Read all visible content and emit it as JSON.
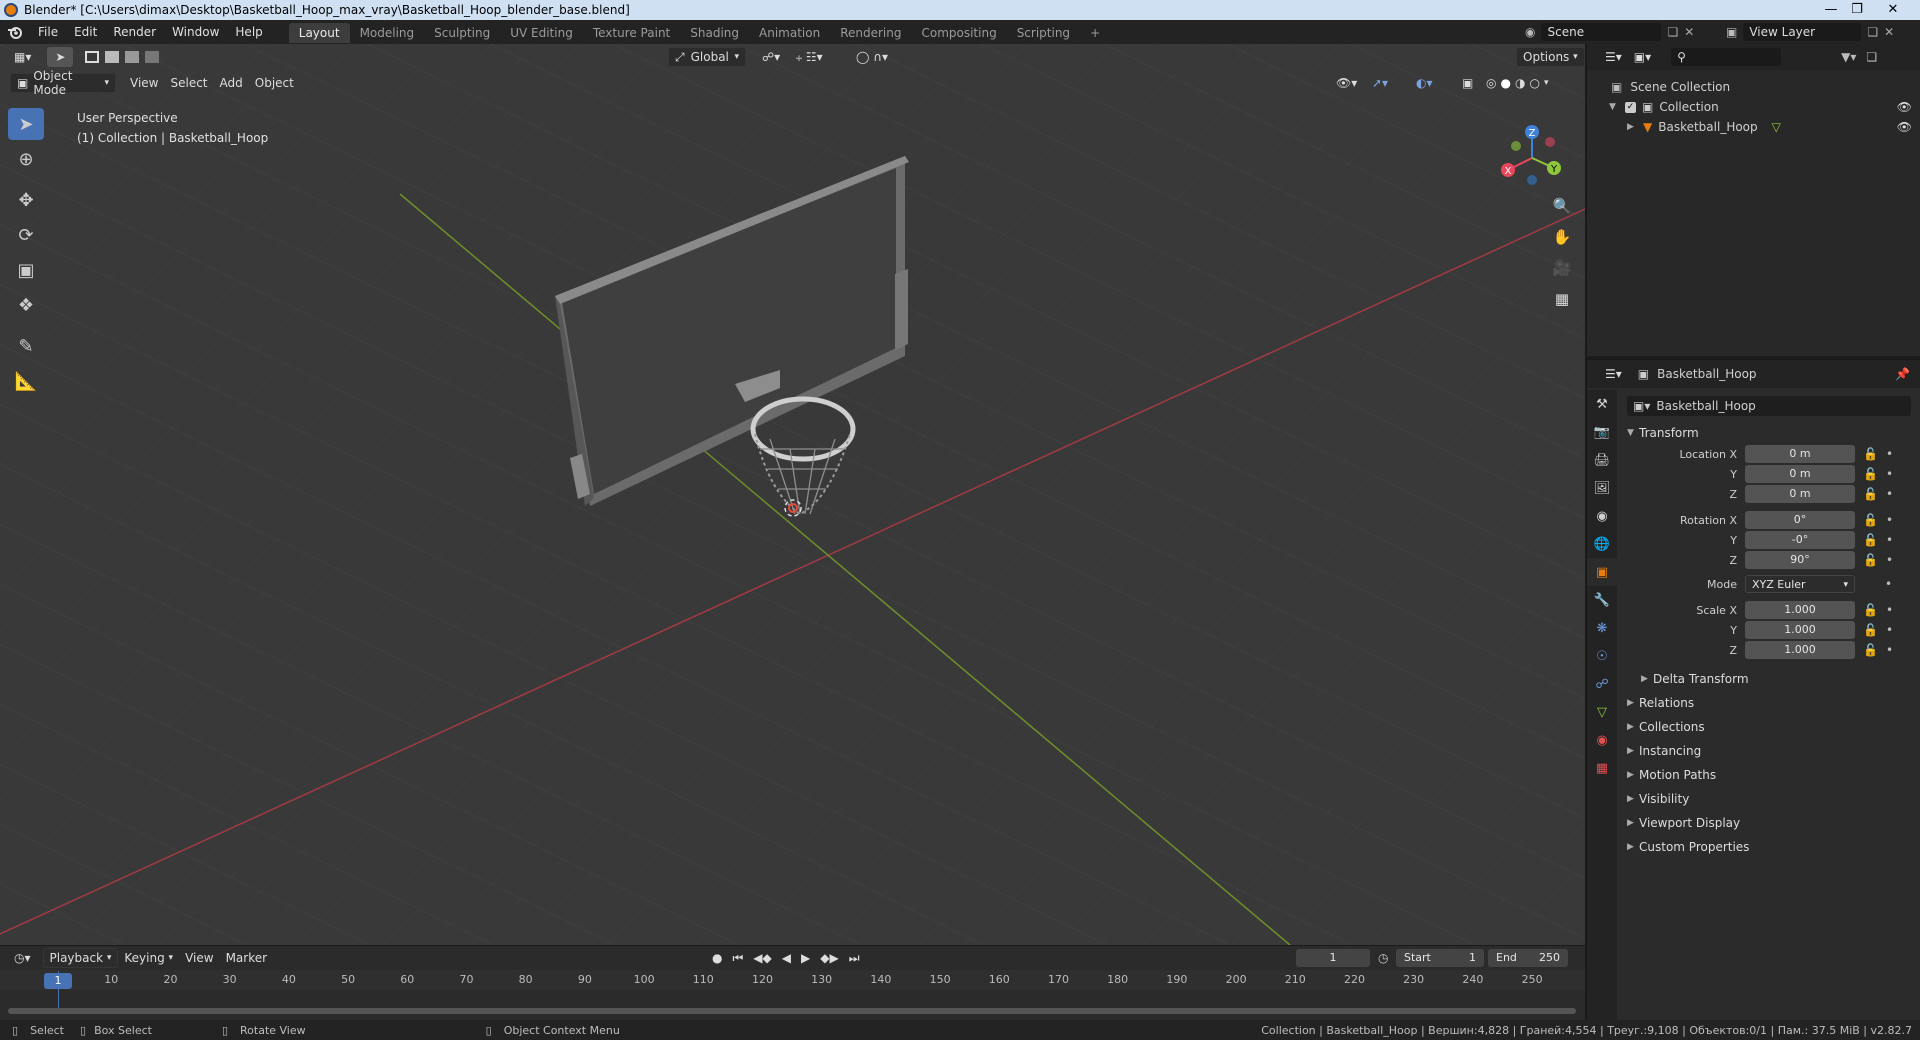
{
  "titlebar": {
    "text": "Blender* [C:\\Users\\dimax\\Desktop\\Basketball_Hoop_max_vray\\Basketball_Hoop_blender_base.blend]"
  },
  "menus": [
    "File",
    "Edit",
    "Render",
    "Window",
    "Help"
  ],
  "workspaces": [
    "Layout",
    "Modeling",
    "Sculpting",
    "UV Editing",
    "Texture Paint",
    "Shading",
    "Animation",
    "Rendering",
    "Compositing",
    "Scripting"
  ],
  "active_workspace": "Layout",
  "scene": {
    "name": "Scene",
    "view_layer": "View Layer"
  },
  "viewport": {
    "mode": "Object Mode",
    "menus": [
      "View",
      "Select",
      "Add",
      "Object"
    ],
    "transform_orientation": "Global",
    "options_label": "Options",
    "overlay_line1": "User Perspective",
    "overlay_line2": "(1) Collection | Basketball_Hoop",
    "gizmo": {
      "x": "X",
      "y": "Y",
      "z": "Z"
    }
  },
  "timeline": {
    "menus": [
      "Playback",
      "Keying",
      "View",
      "Marker"
    ],
    "current_frame": "1",
    "start_label": "Start",
    "start_value": "1",
    "end_label": "End",
    "end_value": "250",
    "ticks": [
      "1",
      "10",
      "20",
      "30",
      "40",
      "50",
      "60",
      "70",
      "80",
      "90",
      "100",
      "110",
      "120",
      "130",
      "140",
      "150",
      "160",
      "170",
      "180",
      "190",
      "200",
      "210",
      "220",
      "230",
      "240",
      "250"
    ]
  },
  "statusbar": {
    "select": "Select",
    "box_select": "Box Select",
    "rotate_view": "Rotate View",
    "context_menu": "Object Context Menu",
    "stats": "Collection | Basketball_Hoop | Вершин:4,828 | Граней:4,554 | Треуг.:9,108 | Объектов:0/1 | Пам.: 37.5 MiB | v2.82.7"
  },
  "outliner": {
    "scene_collection": "Scene Collection",
    "collection": "Collection",
    "object": "Basketball_Hoop"
  },
  "properties": {
    "header_object": "Basketball_Hoop",
    "object_name": "Basketball_Hoop",
    "transform_title": "Transform",
    "location_label": "Location X",
    "location": [
      "0 m",
      "0 m",
      "0 m"
    ],
    "rotation_label": "Rotation X",
    "rotation": [
      "0°",
      "-0°",
      "90°"
    ],
    "mode_label": "Mode",
    "mode_value": "XYZ Euler",
    "scale_label": "Scale X",
    "scale": [
      "1.000",
      "1.000",
      "1.000"
    ],
    "axis_y": "Y",
    "axis_z": "Z",
    "delta_transform": "Delta Transform",
    "panels": [
      "Relations",
      "Collections",
      "Instancing",
      "Motion Paths",
      "Visibility",
      "Viewport Display",
      "Custom Properties"
    ]
  },
  "colors": {
    "accent": "#4772b3",
    "x_axis": "#e8465a",
    "y_axis": "#8fc73a",
    "z_axis": "#3f82d8",
    "object_orange": "#e87d0d"
  }
}
